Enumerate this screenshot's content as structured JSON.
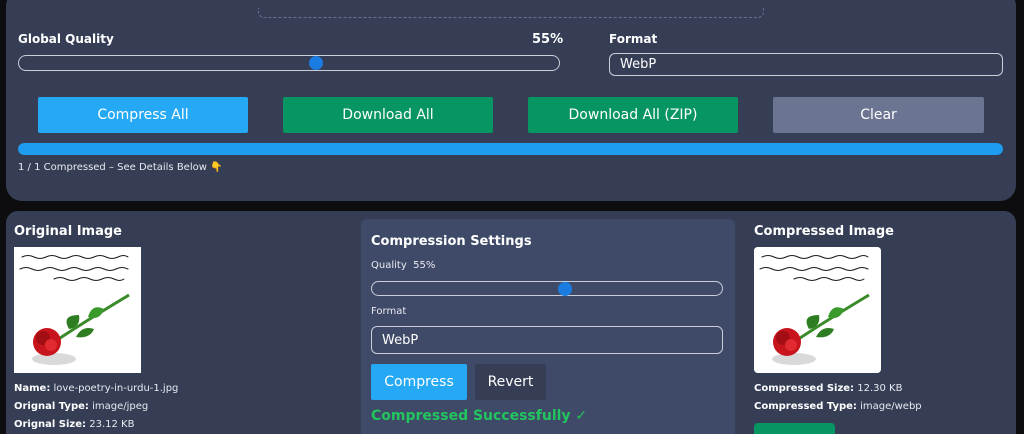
{
  "global": {
    "quality_label": "Global Quality",
    "quality_value": "55%",
    "quality_fraction": 0.55,
    "format_label": "Format",
    "format_value": "WebP"
  },
  "actions": {
    "compress_all": "Compress All",
    "download_all": "Download All",
    "download_zip": "Download All (ZIP)",
    "clear": "Clear"
  },
  "progress": {
    "fraction": 1.0,
    "text": "1 / 1 Compressed – See Details Below 👇"
  },
  "original": {
    "title": "Original Image",
    "name_label": "Name:",
    "name_value": "love-poetry-in-urdu-1.jpg",
    "type_label": "Orignal Type:",
    "type_value": "image/jpeg",
    "size_label": "Orignal Size:",
    "size_value": "23.12 KB"
  },
  "settings": {
    "title": "Compression Settings",
    "quality_label": "Quality",
    "quality_value": "55%",
    "quality_fraction": 0.55,
    "format_label": "Format",
    "format_value": "WebP",
    "compress_button": "Compress",
    "revert_button": "Revert",
    "status": "Compressed Successfully ✓"
  },
  "compressed": {
    "title": "Compressed Image",
    "size_label": "Compressed Size:",
    "size_value": "12.30 KB",
    "type_label": "Compressed Type:",
    "type_value": "image/webp"
  },
  "colors": {
    "panel": "#353e55",
    "card": "#3f4a68",
    "primary": "#26a9f5",
    "success": "#079562",
    "neutral": "#6b7490",
    "slider_thumb": "#1a7ce0",
    "status_green": "#22c55e"
  }
}
